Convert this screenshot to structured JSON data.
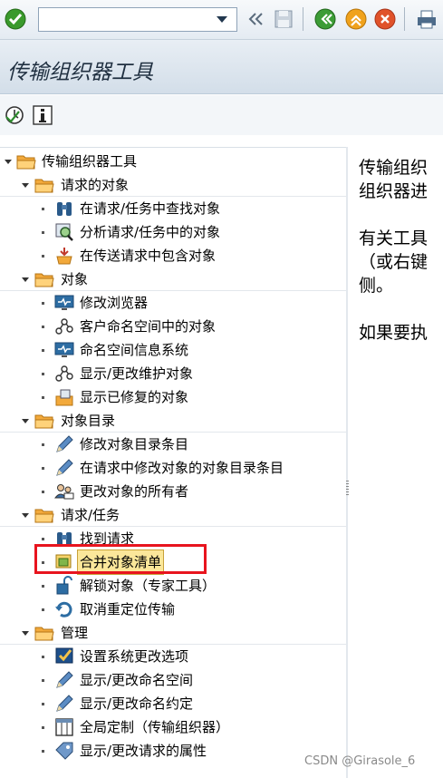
{
  "title": "传输组织器工具",
  "tree": {
    "root": "传输组织器工具",
    "groups": [
      {
        "label": "请求的对象",
        "items": [
          "在请求/任务中查找对象",
          "分析请求/任务中的对象",
          "在传送请求中包含对象"
        ]
      },
      {
        "label": "对象",
        "items": [
          "修改浏览器",
          "客户命名空间中的对象",
          "命名空间信息系统",
          "显示/更改维护对象",
          "显示已修复的对象"
        ]
      },
      {
        "label": "对象目录",
        "items": [
          "修改对象目录条目",
          "在请求中修改对象的对象目录条目",
          "更改对象的所有者"
        ]
      },
      {
        "label": "请求/任务",
        "items": [
          "找到请求",
          "合并对象清单",
          "解锁对象（专家工具）",
          "取消重定位传输"
        ]
      },
      {
        "label": "管理",
        "items": [
          "设置系统更改选项",
          "显示/更改命名空间",
          "显示/更改命名约定",
          "全局定制（传输组织器）",
          "显示/更改请求的属性"
        ]
      }
    ]
  },
  "right_panel": {
    "line1": "传输组织",
    "line2": "组织器进",
    "line3": "有关工具",
    "line4": "（或右键",
    "line5": "侧。",
    "line6": "如果要执"
  },
  "watermark": "CSDN @Girasole_6"
}
